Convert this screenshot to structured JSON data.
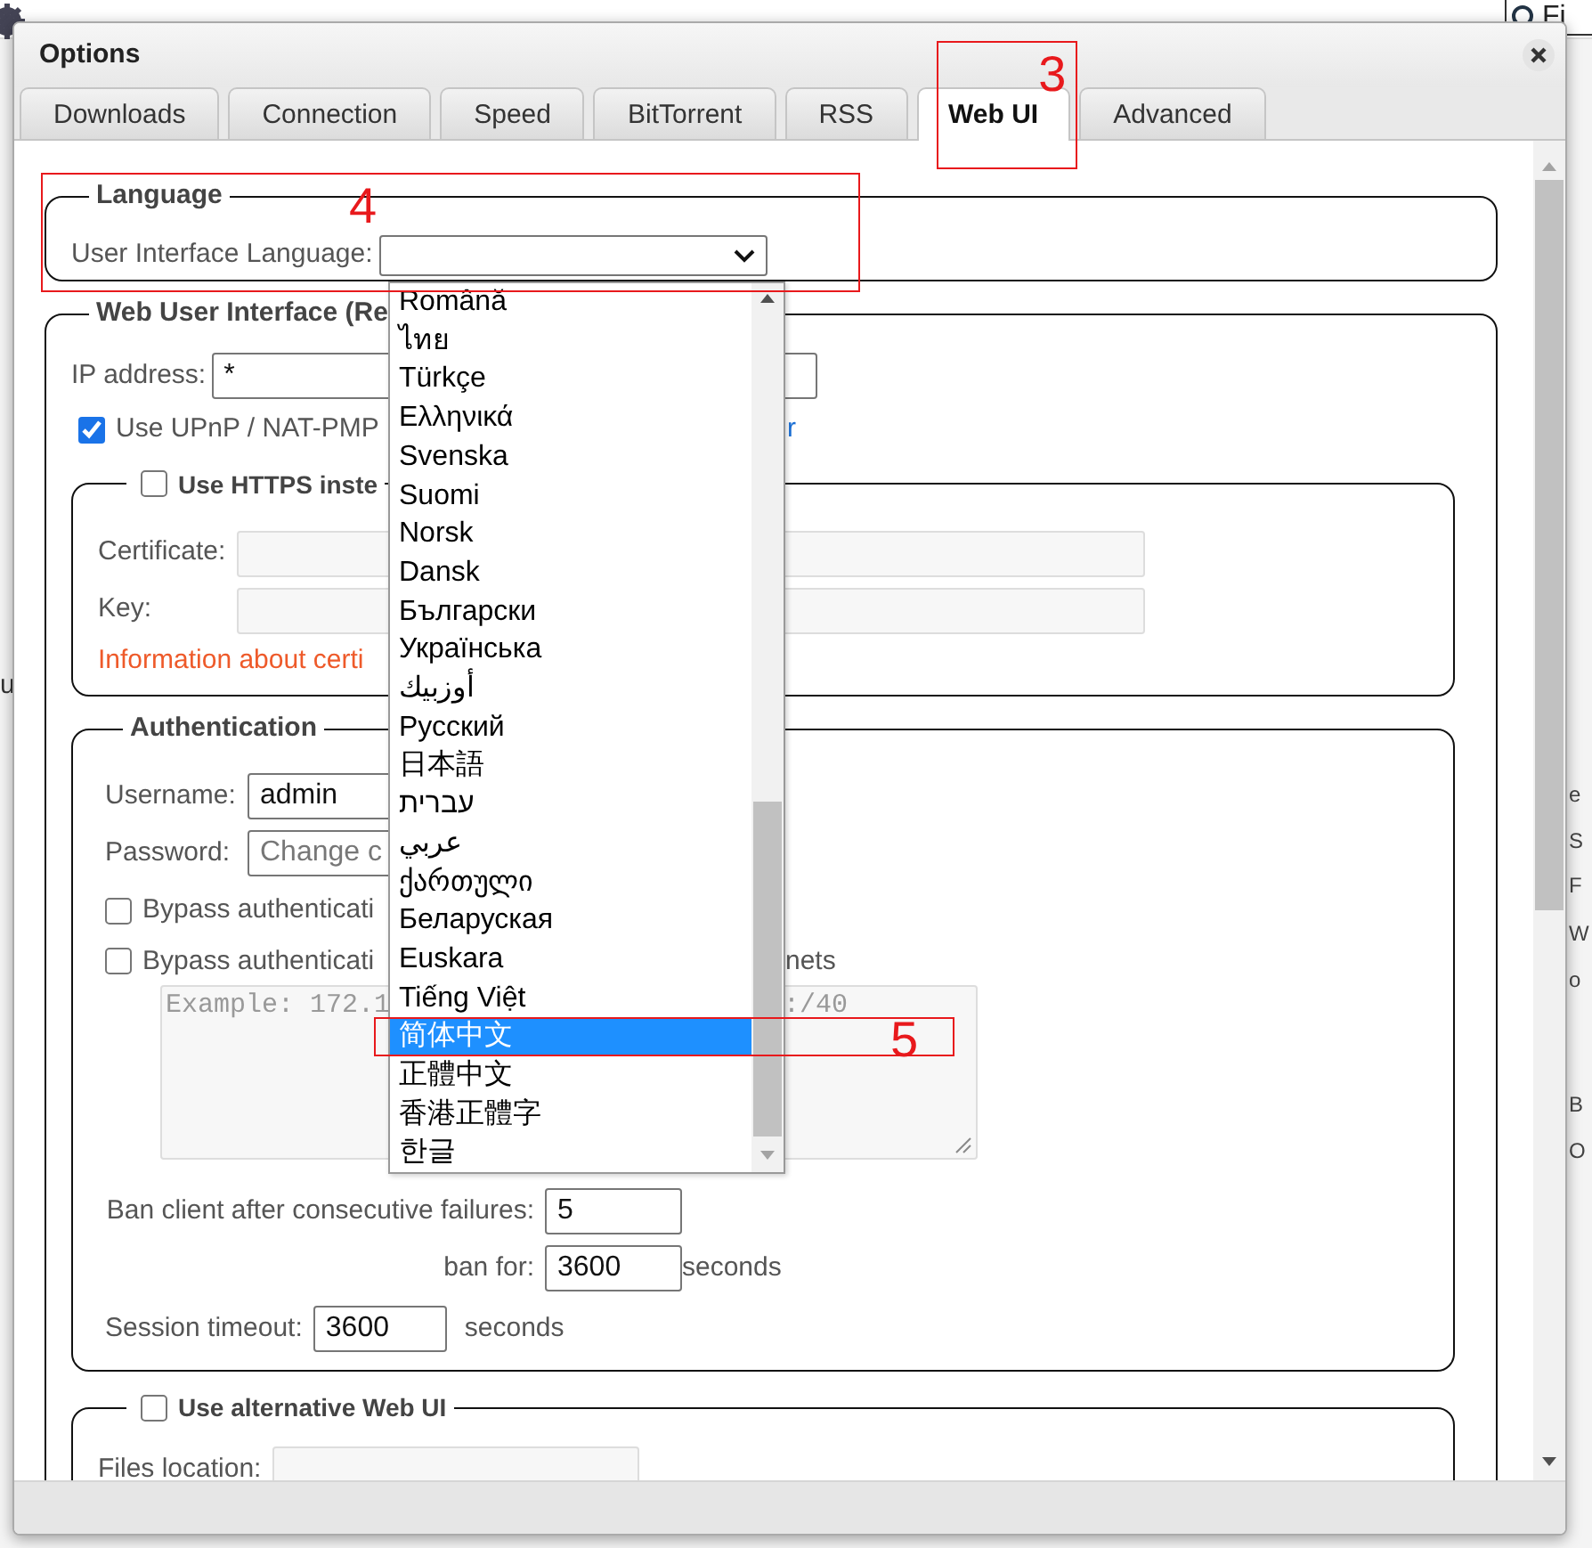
{
  "background": {
    "search_value": "Fi",
    "fragments_left": [
      "u"
    ],
    "fragments_right": [
      "e",
      "S",
      "F",
      "W",
      "o",
      "B",
      "O"
    ]
  },
  "window": {
    "title": "Options"
  },
  "tabs": [
    {
      "label": "Downloads",
      "selected": false
    },
    {
      "label": "Connection",
      "selected": false
    },
    {
      "label": "Speed",
      "selected": false
    },
    {
      "label": "BitTorrent",
      "selected": false
    },
    {
      "label": "RSS",
      "selected": false
    },
    {
      "label": "Web UI",
      "selected": true
    },
    {
      "label": "Advanced",
      "selected": false
    }
  ],
  "language": {
    "legend": "Language",
    "label": "User Interface Language:"
  },
  "web_ui": {
    "legend": "Web User Interface (Re",
    "ip_label": "IP address:",
    "ip_value": "*",
    "upnp": {
      "label": "Use UPnP / NAT-PMP",
      "checked": true,
      "link_fragment": "r"
    },
    "https": {
      "label": "Use HTTPS inste",
      "checked": false,
      "certificate_label": "Certificate:",
      "key_label": "Key:",
      "info": "Information about certi"
    },
    "auth": {
      "legend": "Authentication",
      "username_label": "Username:",
      "username": "admin",
      "password_label": "Password:",
      "password_placeholder": "Change c",
      "bypass": [
        {
          "label": "Bypass authenticati",
          "checked": false
        },
        {
          "label": "Bypass authenticati",
          "tail": "nets",
          "checked": false
        }
      ],
      "subnets_placeholder": "Example: 172.1",
      "subnets_placeholder_tail": ":/40",
      "ban_label": "Ban client after consecutive failures:",
      "ban_value": "5",
      "ban_for_label": "ban for:",
      "ban_for_value": "3600",
      "ban_for_unit": "seconds",
      "timeout_label": "Session timeout:",
      "timeout_value": "3600",
      "timeout_unit": "seconds"
    },
    "alt_web_ui": {
      "label": "Use alternative Web UI",
      "checked": false,
      "files_label": "Files location:"
    }
  },
  "dropdown": {
    "items": [
      {
        "label": "Română",
        "selected": false
      },
      {
        "label": "ไทย",
        "selected": false
      },
      {
        "label": "Türkçe",
        "selected": false
      },
      {
        "label": "Ελληνικά",
        "selected": false
      },
      {
        "label": "Svenska",
        "selected": false
      },
      {
        "label": "Suomi",
        "selected": false
      },
      {
        "label": "Norsk",
        "selected": false
      },
      {
        "label": "Dansk",
        "selected": false
      },
      {
        "label": "Български",
        "selected": false
      },
      {
        "label": "Українська",
        "selected": false
      },
      {
        "label": "أوزبيك",
        "selected": false
      },
      {
        "label": "Русский",
        "selected": false
      },
      {
        "label": "日本語",
        "selected": false
      },
      {
        "label": "עברית",
        "selected": false
      },
      {
        "label": "عربي",
        "selected": false
      },
      {
        "label": "ქართული",
        "selected": false
      },
      {
        "label": "Беларуская",
        "selected": false
      },
      {
        "label": "Euskara",
        "selected": false
      },
      {
        "label": "Tiếng Việt",
        "selected": false
      },
      {
        "label": "简体中文",
        "selected": true
      },
      {
        "label": "正體中文",
        "selected": false
      },
      {
        "label": "香港正體字",
        "selected": false
      },
      {
        "label": "한글",
        "selected": false
      }
    ]
  },
  "annotations": [
    {
      "number": "3"
    },
    {
      "number": "4"
    },
    {
      "number": "5"
    }
  ]
}
